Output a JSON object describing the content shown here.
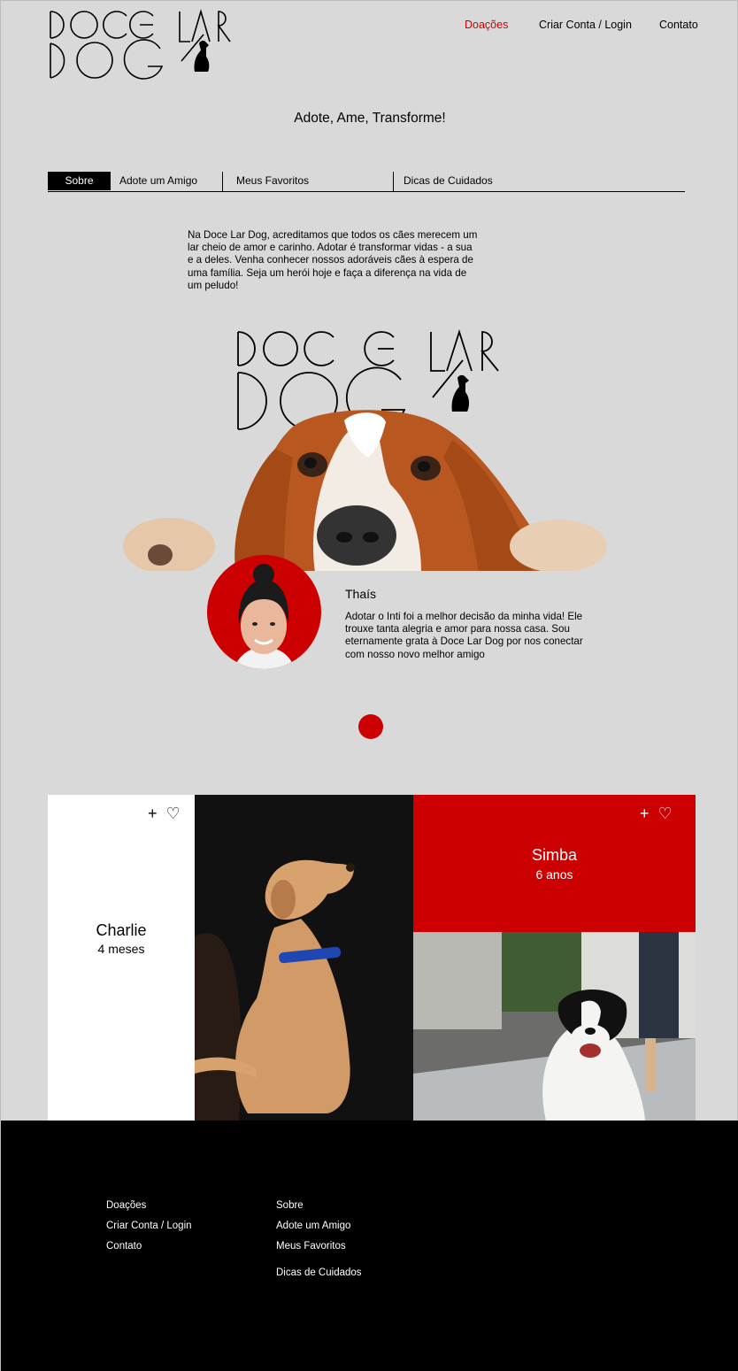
{
  "header": {
    "nav": [
      {
        "label": "Doações",
        "active": true
      },
      {
        "label": "Criar Conta / Login",
        "active": false
      },
      {
        "label": "Contato",
        "active": false
      }
    ]
  },
  "tagline": "Adote, Ame, Transforme!",
  "tabs": [
    {
      "label": "Sobre",
      "active": true
    },
    {
      "label": "Adote um Amigo",
      "active": false
    },
    {
      "label": "Meus Favoritos",
      "active": false
    },
    {
      "label": "Dicas de Cuidados",
      "active": false
    }
  ],
  "about_text": "Na Doce Lar Dog, acreditamos que todos os cães merecem um lar cheio de amor e carinho. Adotar é transformar vidas - a sua e a deles. Venha conhecer nossos adoráveis cães à espera de uma família. Seja um herói hoje e faça a diferença na vida de um peludo!",
  "testimonial": {
    "name": "Thaís",
    "text": "Adotar o Inti foi a melhor decisão da minha vida! Ele trouxe tanta alegria e amor para nossa casa. Sou eternamente grata à Doce Lar Dog por nos conectar com nosso novo melhor amigo"
  },
  "pets": [
    {
      "name": "Charlie",
      "age": "4 meses"
    },
    {
      "name": "Simba",
      "age": "6 anos"
    }
  ],
  "card_icons": {
    "add": "+",
    "favorite": "♡"
  },
  "footer": {
    "col1": [
      "Doações",
      "Criar Conta / Login",
      "Contato"
    ],
    "col2": [
      "Sobre",
      "Adote um Amigo",
      "Meus Favoritos",
      "Dicas de Cuidados"
    ]
  },
  "colors": {
    "accent": "#cc0000",
    "background": "#d9d9d9",
    "footer": "#000000"
  }
}
